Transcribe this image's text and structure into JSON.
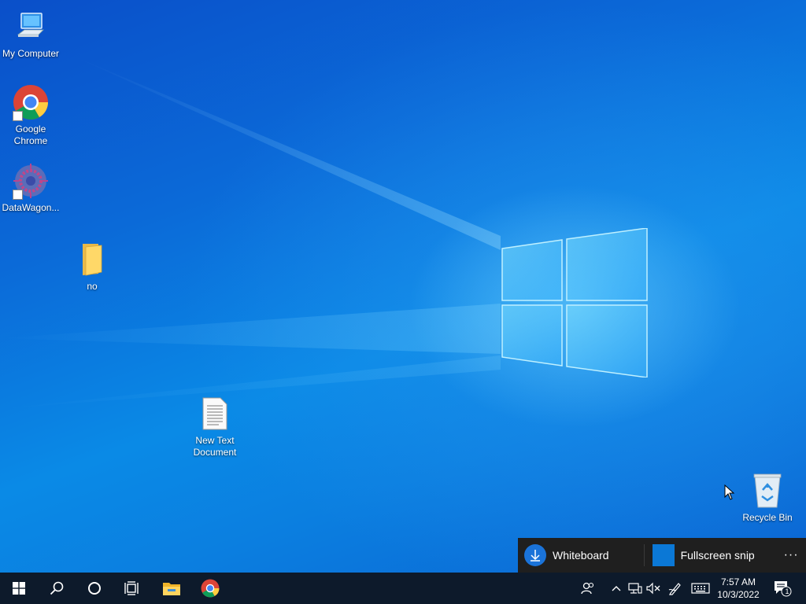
{
  "desktop": {
    "icons": [
      {
        "label": "My Computer",
        "icon": "computer-icon"
      },
      {
        "label": "Google\nChrome",
        "icon": "chrome-icon"
      },
      {
        "label": "DataWagon...",
        "icon": "datawagon-icon"
      },
      {
        "label": "no",
        "icon": "folder-icon"
      },
      {
        "label": "New Text\nDocument",
        "icon": "text-document-icon"
      },
      {
        "label": "Recycle Bin",
        "icon": "recycle-bin-icon"
      }
    ]
  },
  "toast": {
    "whiteboard_label": "Whiteboard",
    "fullscreen_label": "Fullscreen snip",
    "more_label": "···"
  },
  "taskbar": {
    "items": [
      "start-icon",
      "search-icon",
      "cortana-icon",
      "task-view-icon",
      "file-explorer-icon",
      "chrome-icon"
    ],
    "tray": [
      "people-icon",
      "chevron-up-icon",
      "network-icon",
      "volume-muted-icon",
      "pen-icon",
      "keyboard-icon"
    ],
    "time": "7:57 AM",
    "date": "10/3/2022",
    "notification_count": "1"
  },
  "colors": {
    "taskbar": "#0d1a2b",
    "accent": "#1a73d9",
    "desktop": "#0a7ae0"
  }
}
